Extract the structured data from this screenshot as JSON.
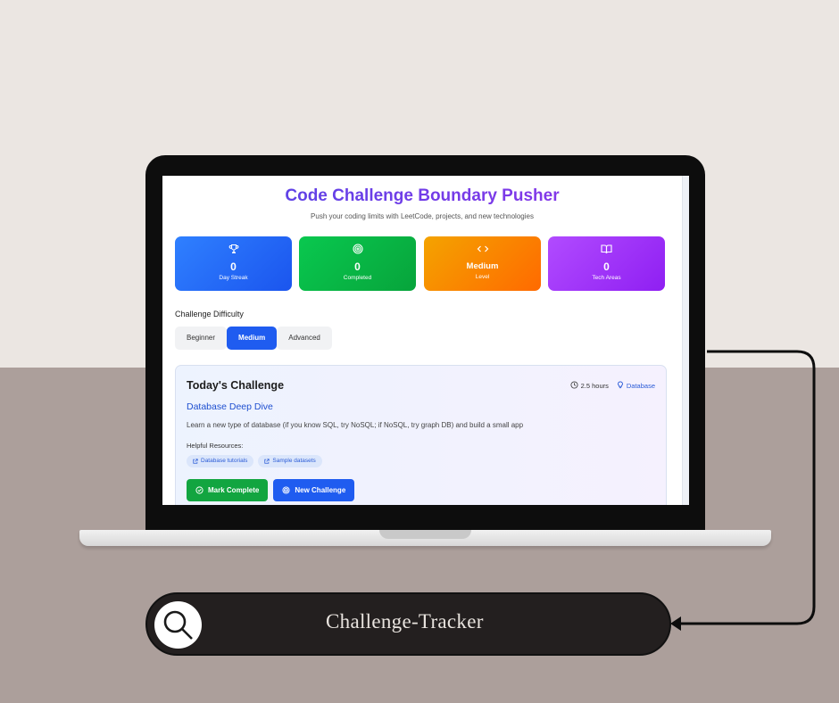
{
  "app": {
    "title": "Code Challenge Boundary Pusher",
    "subtitle": "Push your coding limits with LeetCode, projects, and new technologies"
  },
  "stats": [
    {
      "icon": "trophy-icon",
      "value": "0",
      "label": "Day Streak",
      "color_from": "#2f80ff",
      "color_to": "#1b55ee"
    },
    {
      "icon": "target-icon",
      "value": "0",
      "label": "Completed",
      "color_from": "#09c84f",
      "color_to": "#07a43b"
    },
    {
      "icon": "code-icon",
      "value": "Medium",
      "label": "Level",
      "color_from": "#f4a300",
      "color_to": "#ff6a00"
    },
    {
      "icon": "book-icon",
      "value": "0",
      "label": "Tech Areas",
      "color_from": "#b14bff",
      "color_to": "#8f1ff2"
    }
  ],
  "difficulty": {
    "label": "Challenge Difficulty",
    "options": [
      "Beginner",
      "Medium",
      "Advanced"
    ],
    "selected": "Medium"
  },
  "challenge": {
    "heading": "Today's Challenge",
    "time": "2.5 hours",
    "category": "Database",
    "name": "Database Deep Dive",
    "description": "Learn a new type of database (if you know SQL, try NoSQL; if NoSQL, try graph DB) and build a small app",
    "resources_label": "Helpful Resources:",
    "resources": [
      "Database tutorials",
      "Sample datasets"
    ],
    "complete_label": "Mark Complete",
    "new_label": "New Challenge"
  },
  "search_pill": {
    "text": "Challenge-Tracker"
  },
  "colors": {
    "accent_blue": "#1f5cf0",
    "accent_green": "#12a540",
    "pill_bg": "#231f1f",
    "wall": "#ebe6e2",
    "desk": "#ac9f9b"
  }
}
